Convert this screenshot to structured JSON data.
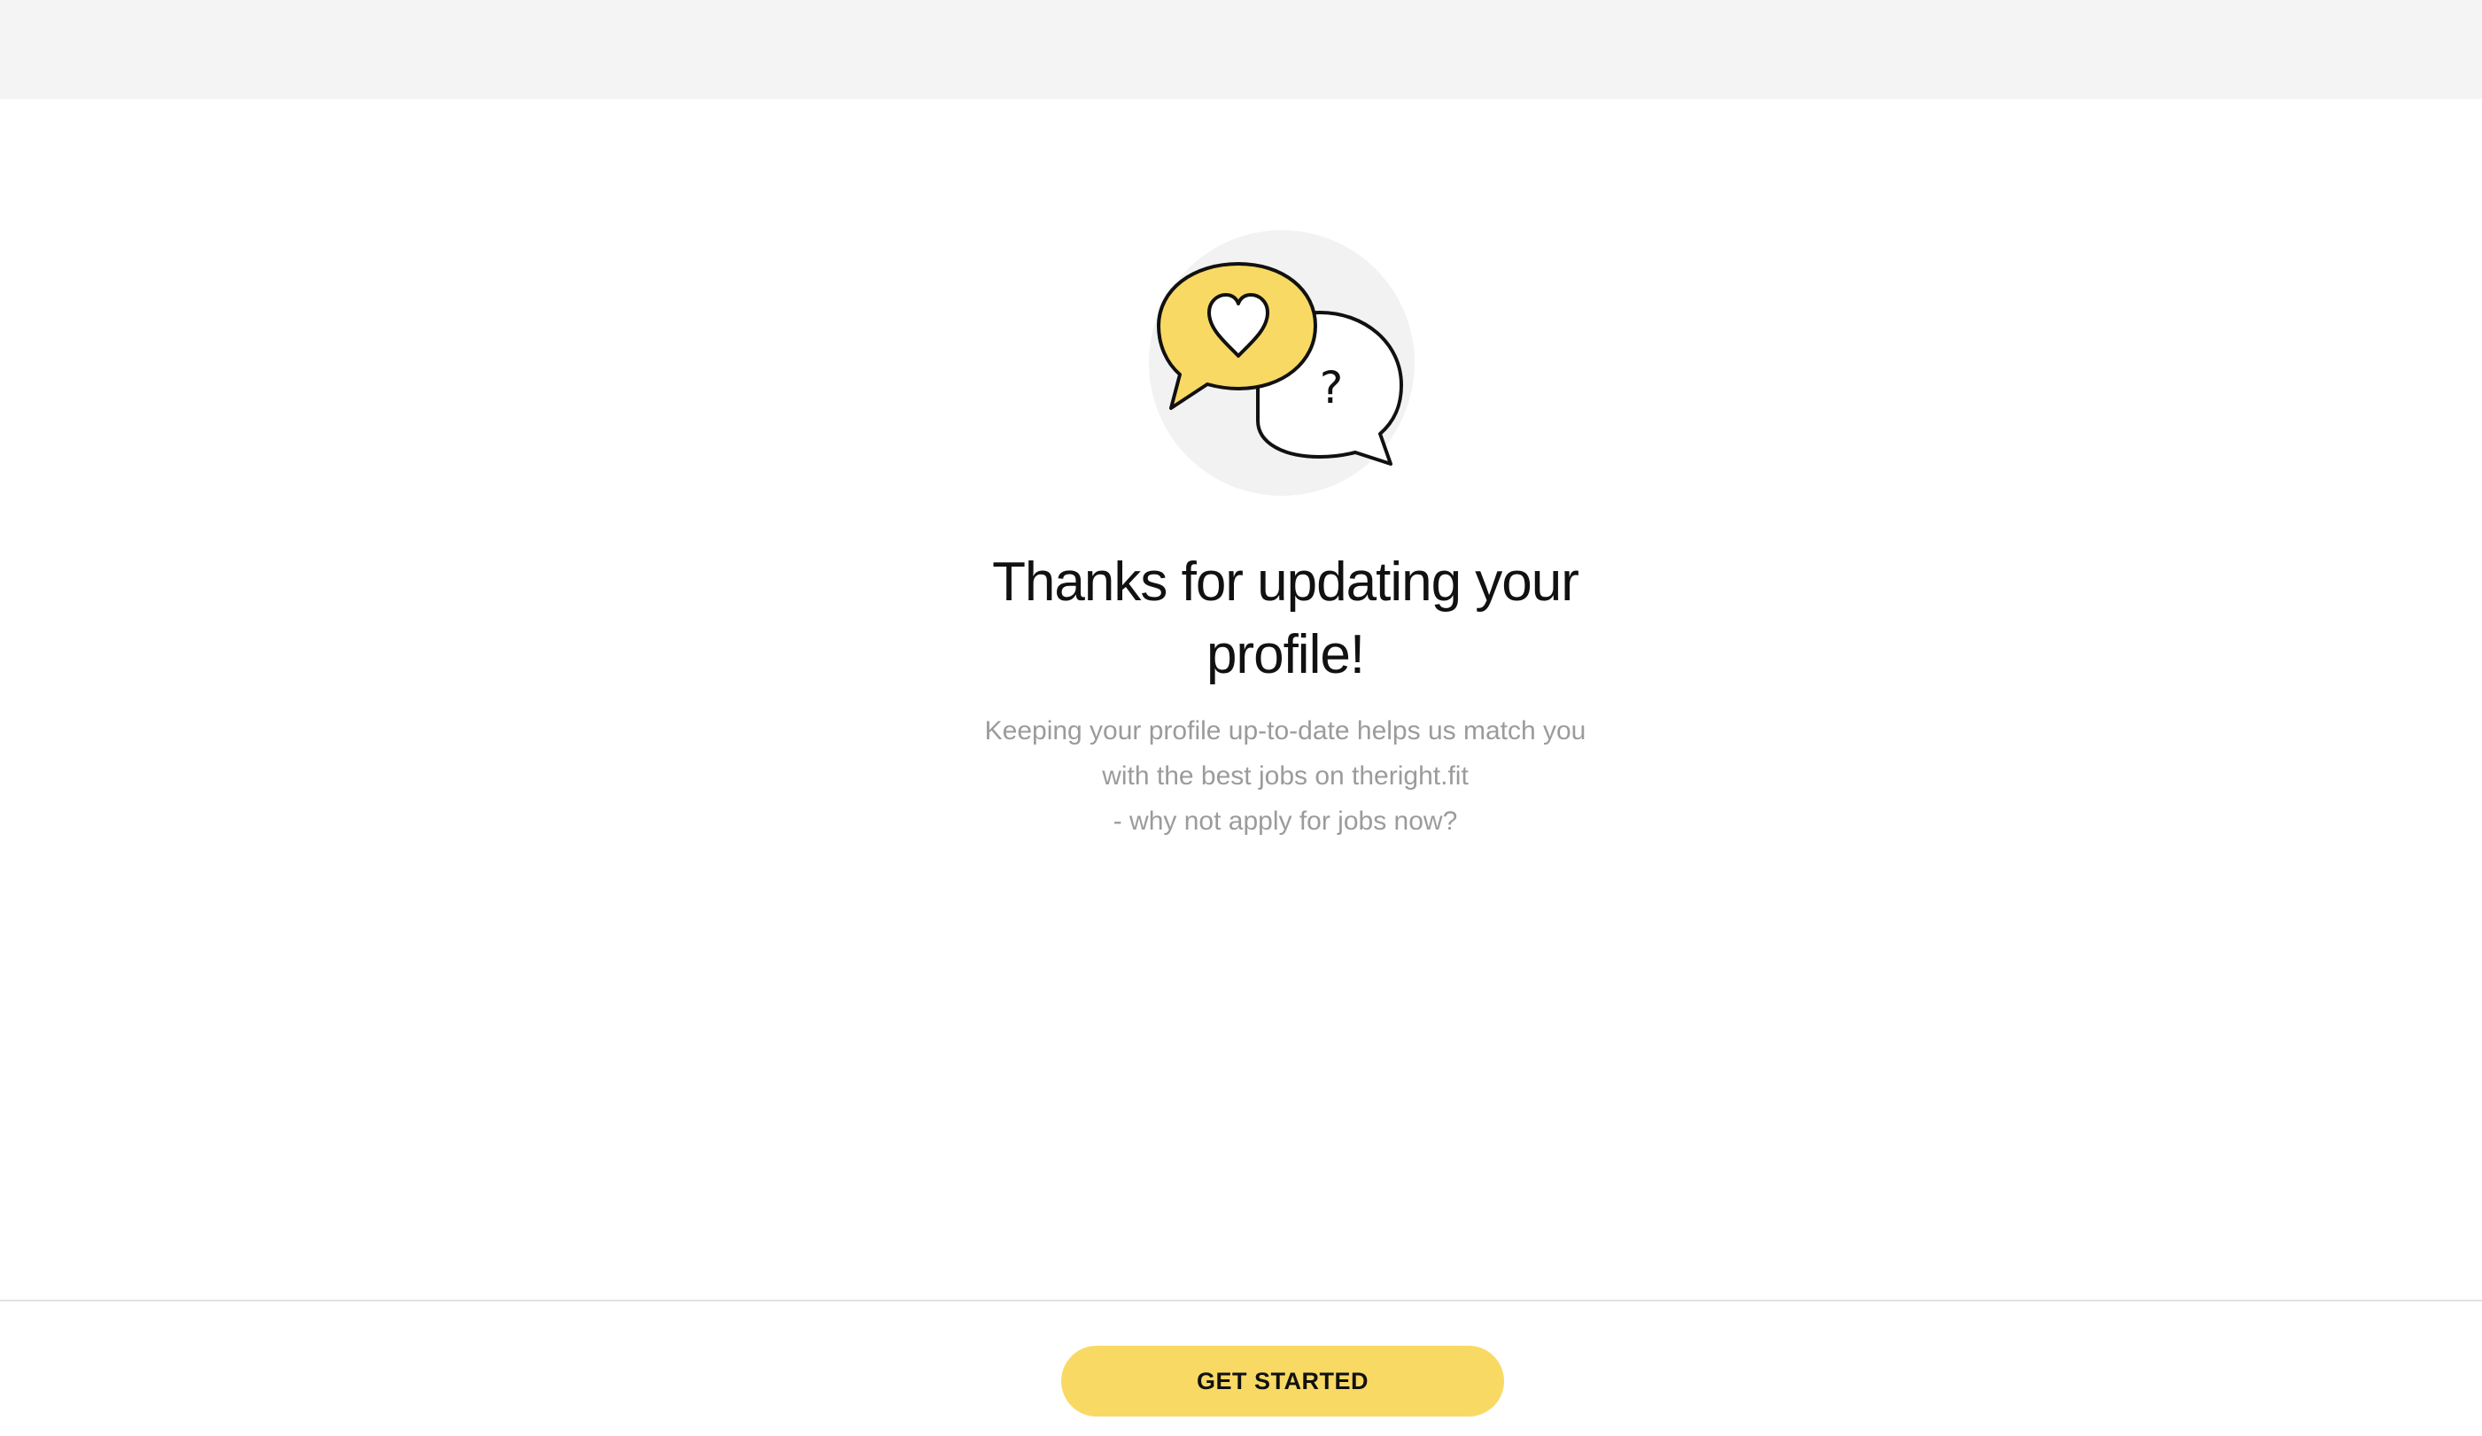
{
  "main": {
    "title_line1": "Thanks for updating your",
    "title_line2": "profile!",
    "message_line1": "Keeping your profile up-to-date helps us match you",
    "message_line2": "with the best jobs on theright.fit",
    "message_line3": "- why not apply for jobs now?"
  },
  "illustration": {
    "icons": [
      "speech-bubble-heart-icon",
      "speech-bubble-question-icon"
    ],
    "question_mark": "?"
  },
  "footer": {
    "cta_label": "GET STARTED"
  },
  "colors": {
    "accent_yellow": "#f8d964",
    "top_bar_bg": "#f4f4f4",
    "illustration_circle": "#f2f2f2",
    "title_text": "#111111",
    "body_text": "#9b9b9b"
  }
}
